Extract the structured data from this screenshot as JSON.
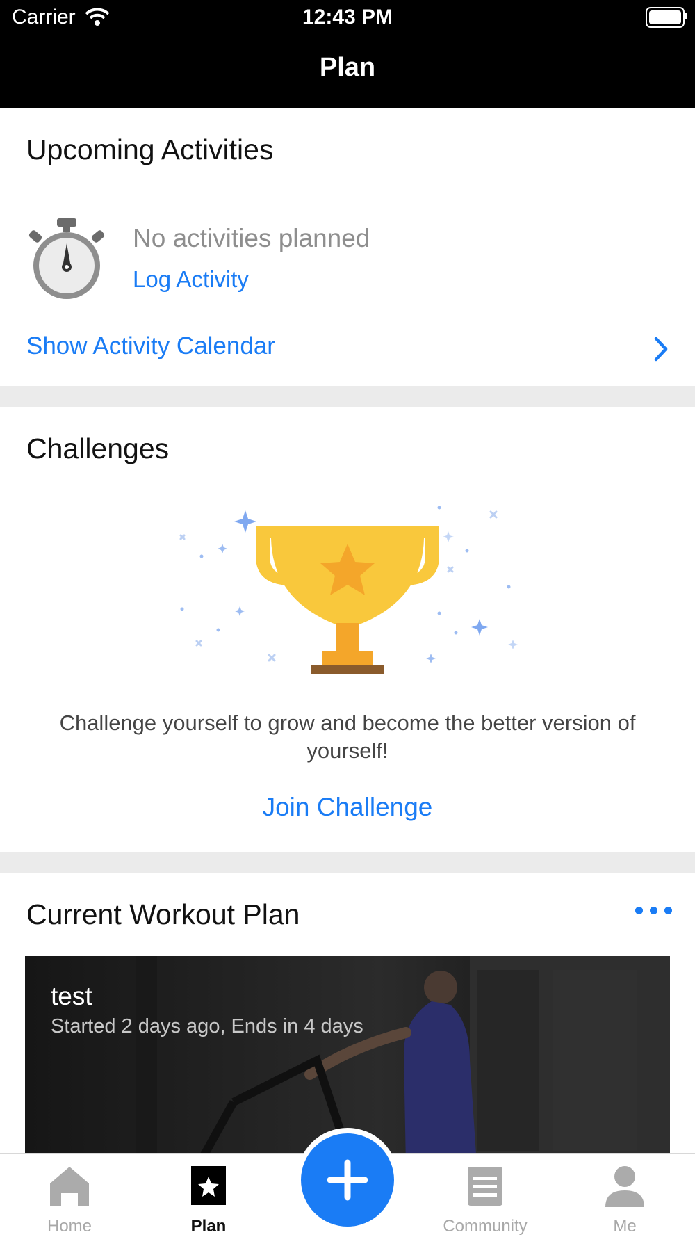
{
  "status_bar": {
    "carrier": "Carrier",
    "time": "12:43 PM"
  },
  "nav": {
    "title": "Plan"
  },
  "upcoming": {
    "title": "Upcoming Activities",
    "empty_text": "No activities planned",
    "log_activity": "Log Activity",
    "show_calendar": "Show Activity Calendar"
  },
  "challenges": {
    "title": "Challenges",
    "text": "Challenge yourself to grow and become the better version of yourself!",
    "join": "Join Challenge"
  },
  "workout_plan": {
    "title": "Current Workout Plan",
    "plan_name": "test",
    "plan_status": "Started 2 days ago, Ends in 4 days"
  },
  "tabs": [
    {
      "label": "Home",
      "icon": "home-icon",
      "active": false
    },
    {
      "label": "Plan",
      "icon": "plan-star-icon",
      "active": true
    },
    {
      "label": "Community",
      "icon": "community-icon",
      "active": false
    },
    {
      "label": "Me",
      "icon": "person-icon",
      "active": false
    }
  ],
  "colors": {
    "accent": "#1a7cf5",
    "trophy": "#f9c83c",
    "star": "#f4a62a"
  }
}
